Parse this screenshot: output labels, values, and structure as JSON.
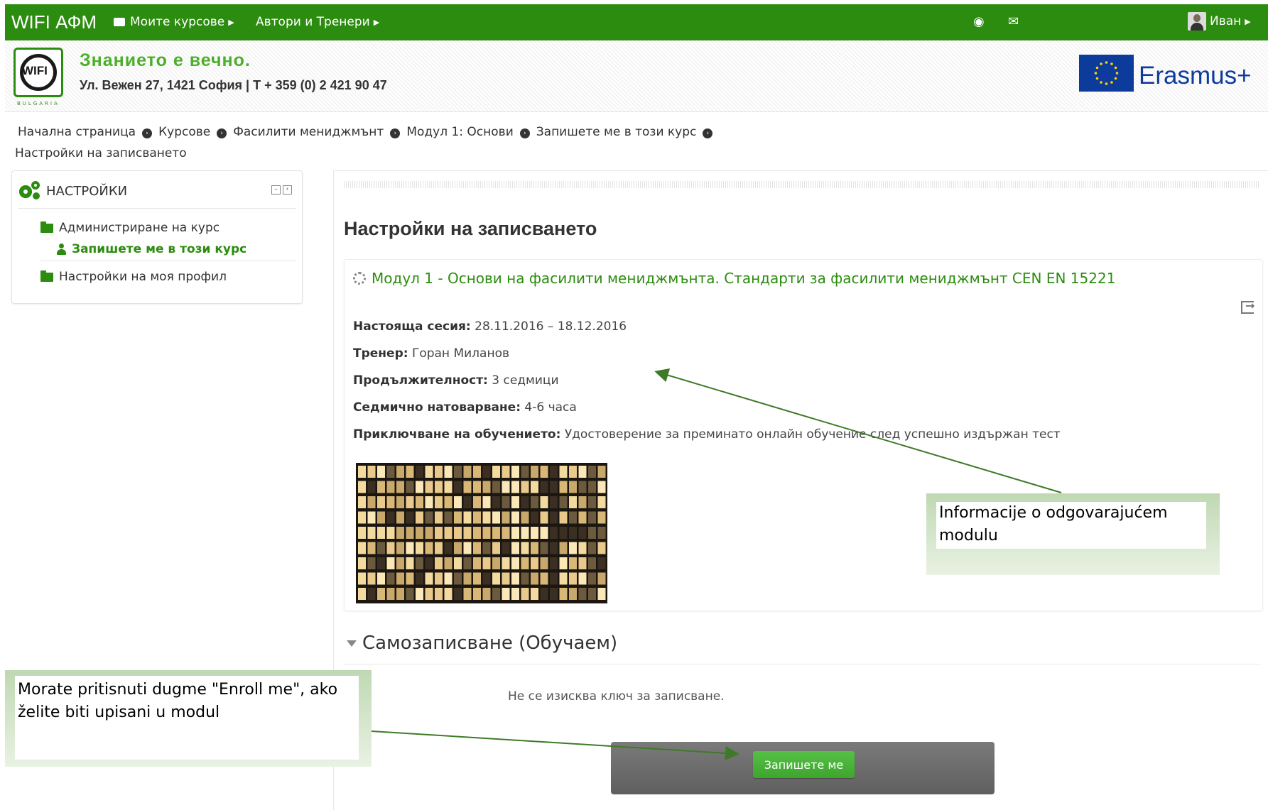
{
  "topbar": {
    "brand": "WIFI АФМ",
    "nav": [
      {
        "label": "Моите курсове"
      },
      {
        "label": "Автори и Тренери"
      }
    ],
    "user_name": "Иван"
  },
  "header": {
    "tagline": "Знанието е вечно.",
    "address": "Ул. Вежен 27, 1421 София | Т + 359 (0) 2 421 90 47",
    "logo_text": "WIFI",
    "logo_sub": "BULGARIA",
    "erasmus": "Erasmus+"
  },
  "breadcrumb": {
    "items": [
      "Начална страница",
      "Курсове",
      "Фасилити мениджмънт",
      "Модул 1: Основи",
      "Запишете ме в този курс",
      "Настройки на записването"
    ]
  },
  "settings_block": {
    "title": "НАСТРОЙКИ",
    "items": [
      {
        "label": "Администриране на курс"
      },
      {
        "label": "Запишете ме в този курс"
      },
      {
        "label": "Настройки на моя профил"
      }
    ]
  },
  "main": {
    "title": "Настройки на записването",
    "course_title": "Модул 1 - Основи на фасилити мениджмънта. Стандарти за фасилити мениджмънт CEN EN 15221",
    "info": [
      {
        "label": "Настояща сесия:",
        "value": "28.11.2016 – 18.12.2016"
      },
      {
        "label": "Тренер:",
        "value": "Горан Миланов"
      },
      {
        "label": "Продължителност:",
        "value": "3 седмици"
      },
      {
        "label": "Седмично натоварване:",
        "value": "4-6 часа"
      },
      {
        "label": "Приключване на обучението:",
        "value": "Удостоверение за преминато онлайн обучение след успешно издържан тест"
      }
    ],
    "self_enrol_title": "Самозаписване (Обучаем)",
    "no_key_text": "Не се изисква ключ за записване.",
    "enroll_button": "Запишете ме"
  },
  "callouts": {
    "module_info": "Informacije o odgovarajućem modulu",
    "enroll_hint": "Morate pritisnuti dugme \"Enroll me\", ako želite biti upisani u modul"
  },
  "colors": {
    "brand_green": "#2c8c0f",
    "link_green": "#2c8c0f",
    "erasmus_blue": "#0d3b9c",
    "button_green": "#4cb33a",
    "callout_frame": "#c6dcb9",
    "arrow": "#3f7a28"
  }
}
